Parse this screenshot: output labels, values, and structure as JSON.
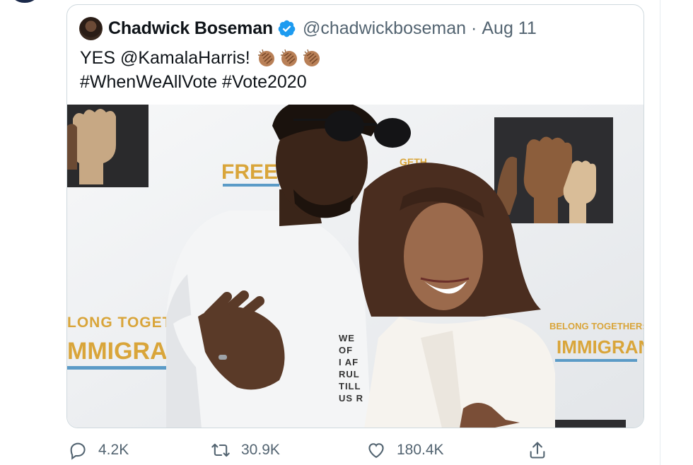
{
  "quoted_tweet": {
    "author_name": "Chadwick Boseman",
    "handle": "@chadwickboseman",
    "separator": "·",
    "date": "Aug 11",
    "text_line1": "YES @KamalaHarris!",
    "text_line2": "#WhenWeAllVote #Vote2020",
    "verified": true,
    "emoji": [
      "clap-icon",
      "clap-icon",
      "clap-icon"
    ],
    "photo": {
      "backdrop_text_left_1": "FREED",
      "backdrop_text_left_2": "GETH",
      "backdrop_text_left_3": "LONG TOGET",
      "backdrop_text_left_4": "MMIGRANT",
      "backdrop_text_right_1": "BELONG TOGETHER:",
      "backdrop_text_right_2": "IMMIGRANTS!",
      "shirt_text": [
        "WE OF",
        "I AF",
        "RUL",
        "TILL",
        "US R"
      ]
    }
  },
  "actions": {
    "reply_count": "4.2K",
    "retweet_count": "30.9K",
    "like_count": "180.4K"
  },
  "colors": {
    "verified": "#1d9bf0",
    "secondary_text": "#536471",
    "border": "#cfd9de",
    "backdrop_gold": "#d9a53a",
    "backdrop_blue": "#5b9bc7"
  }
}
